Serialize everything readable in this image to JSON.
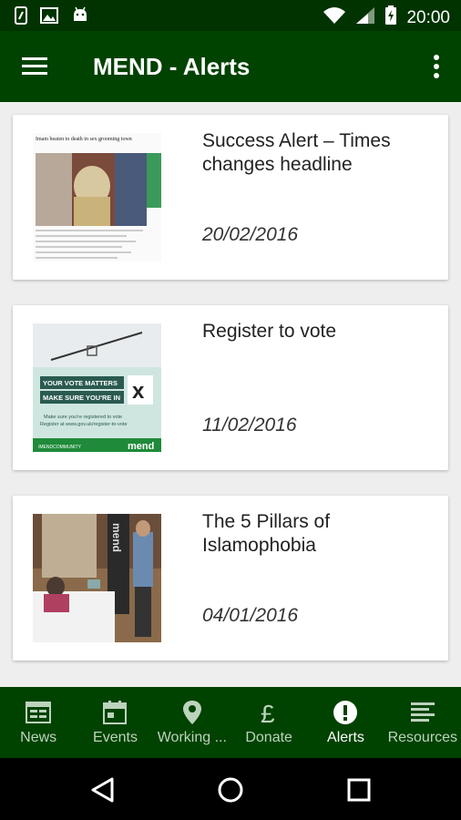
{
  "status_bar": {
    "time": "20:00",
    "left_icons": [
      "phone-icon",
      "image-icon",
      "android-icon"
    ],
    "right_icons": [
      "wifi-icon",
      "signal-icon",
      "battery-icon"
    ]
  },
  "app_bar": {
    "title": "MEND - Alerts"
  },
  "alerts": [
    {
      "title": "Success Alert – Times changes headline",
      "date": "20/02/2016",
      "thumb_text": "Imam beaten to death in sex grooming town"
    },
    {
      "title": "Register to vote",
      "date": "11/02/2016",
      "thumb_text": {
        "line1": "YOUR VOTE MATTERS",
        "line2": "MAKE SURE YOU'RE IN",
        "small1": "Make sure you're registered to vote",
        "small2": "Register at www.gov.uk/register-to-vote",
        "footer": "/MENDCOMMUNITY",
        "brand": "mend"
      }
    },
    {
      "title": "The 5 Pillars of Islamophobia",
      "date": "04/01/2016",
      "thumb_text": "mend"
    }
  ],
  "bottom_nav": [
    {
      "label": "News",
      "icon": "news-icon",
      "active": false
    },
    {
      "label": "Events",
      "icon": "calendar-icon",
      "active": false
    },
    {
      "label": "Working ...",
      "icon": "location-pin-icon",
      "active": false
    },
    {
      "label": "Donate",
      "icon": "pound-icon",
      "active": false
    },
    {
      "label": "Alerts",
      "icon": "alert-icon",
      "active": true
    },
    {
      "label": "Resources",
      "icon": "resources-icon",
      "active": false
    }
  ],
  "colors": {
    "status_bar": "#003300",
    "app_bar": "#004200",
    "nav_inactive": "#bcd3bc",
    "nav_active": "#ffffff"
  }
}
